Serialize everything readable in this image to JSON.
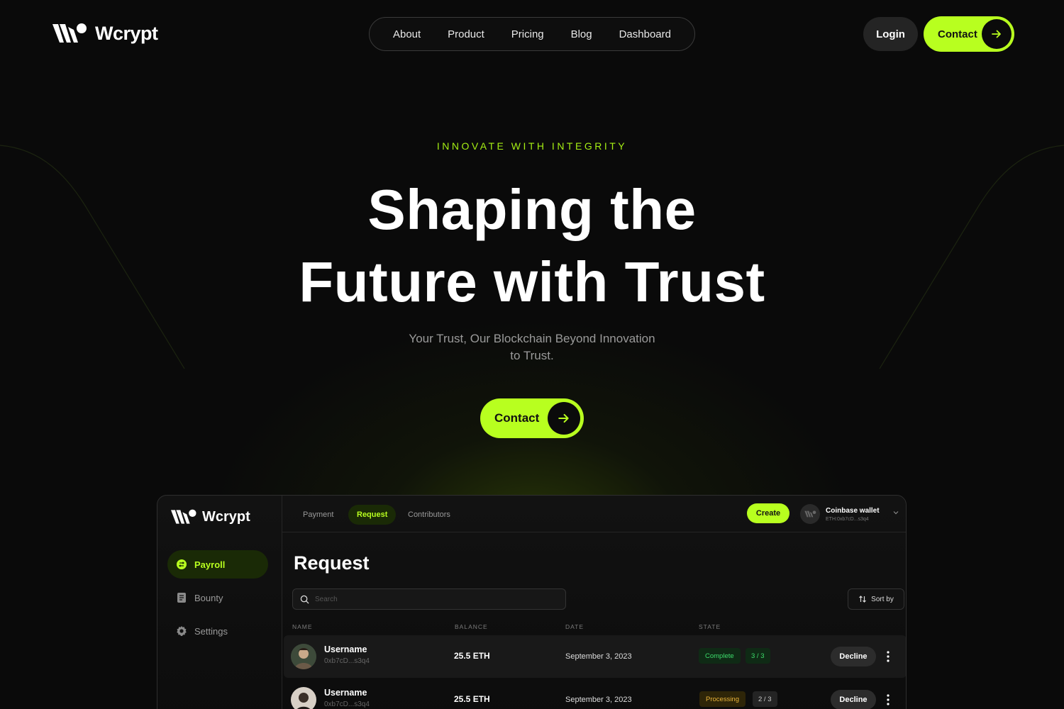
{
  "brand": {
    "name": "Wcrypt"
  },
  "nav": {
    "links": [
      "About",
      "Product",
      "Pricing",
      "Blog",
      "Dashboard"
    ],
    "login_label": "Login",
    "contact_label": "Contact"
  },
  "hero": {
    "eyebrow": "INNOVATE WITH INTEGRITY",
    "title_line1": "Shaping the",
    "title_line2": "Future with Trust",
    "subtitle": "Your Trust, Our Blockchain Beyond Innovation to Trust.",
    "cta_label": "Contact"
  },
  "colors": {
    "accent": "#b8ff1f",
    "background": "#0a0a0a"
  },
  "dashboard": {
    "brand": "Wcrypt",
    "sidebar": [
      {
        "label": "Payroll",
        "icon": "payroll-icon",
        "active": true
      },
      {
        "label": "Bounty",
        "icon": "document-icon",
        "active": false
      },
      {
        "label": "Settings",
        "icon": "gear-icon",
        "active": false
      }
    ],
    "tabs": [
      {
        "label": "Payment",
        "active": false
      },
      {
        "label": "Request",
        "active": true
      },
      {
        "label": "Contributors",
        "active": false
      }
    ],
    "create_label": "Create",
    "wallet": {
      "name": "Coinbase wallet",
      "address": "ETH:0xb7cD...s3q4"
    },
    "heading": "Request",
    "search_placeholder": "Search",
    "sort_label": "Sort by",
    "columns": [
      "NAME",
      "BALANCE",
      "DATE",
      "STATE"
    ],
    "rows": [
      {
        "username": "Username",
        "address": "0xb7cD...s3q4",
        "balance": "25.5 ETH",
        "date": "September 3, 2023",
        "state": "Complete",
        "progress": "3 / 3",
        "action": "Decline"
      },
      {
        "username": "Username",
        "address": "0xb7cD...s3q4",
        "balance": "25.5 ETH",
        "date": "September 3, 2023",
        "state": "Processing",
        "progress": "2 / 3",
        "action": "Decline"
      }
    ]
  }
}
